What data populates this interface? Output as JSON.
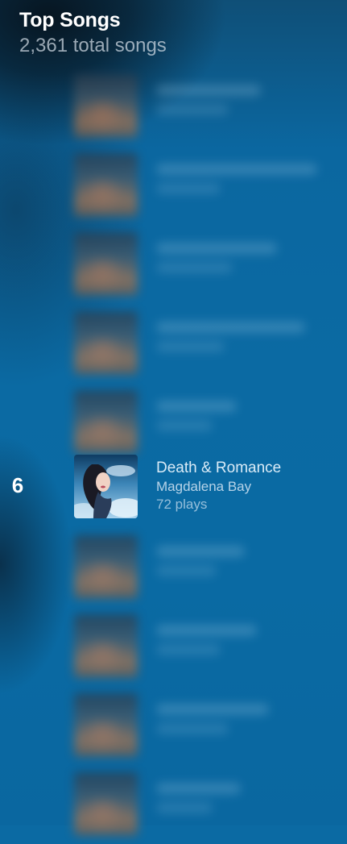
{
  "header": {
    "title": "Top Songs",
    "subtitle": "2,361 total songs"
  },
  "featured": {
    "rank": "6",
    "title": "Death & Romance",
    "artist": "Magdalena Bay",
    "plays": "72 plays",
    "cover_icon": "album-art-image"
  },
  "colors": {
    "background": "#0b6aa3",
    "title_text": "#ffffff",
    "song_title": "#d9ebf7",
    "artist_text": "#b6d3e8"
  }
}
